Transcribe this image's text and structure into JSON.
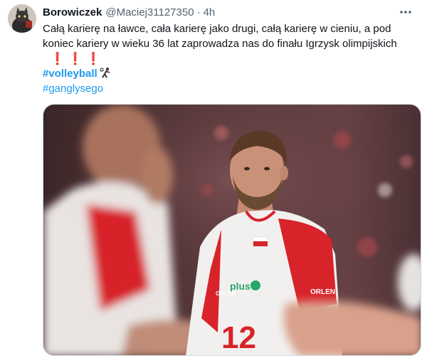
{
  "tweet": {
    "author_name": "Borowiczek",
    "handle": "@Maciej31127350",
    "separator": "·",
    "time": "4h",
    "text_line1": "Całą karierę na ławce, cała karierę jako drugi, całą karierę w cieniu, a pod",
    "text_line2": "koniec kariery w wieku 36 lat zaprowadza nas do finału Igrzysk olimpijskich",
    "exclamations": [
      "❗",
      "❗",
      "❗"
    ],
    "hashtags": [
      "#volleyball",
      "#ganglysego"
    ]
  },
  "photo": {
    "jersey_number": "12",
    "sponsor_text": "plus",
    "left_jersey_text": "ORLEN",
    "right_jersey_text": "ORLEN"
  },
  "icons": {
    "more": "more-options-icon",
    "volleyball": "volleyball-player-icon"
  },
  "colors": {
    "link": "#1d9bf0",
    "secondary_text": "#536471",
    "exclamation": "#dd2e44",
    "jersey_red": "#d8232a"
  }
}
